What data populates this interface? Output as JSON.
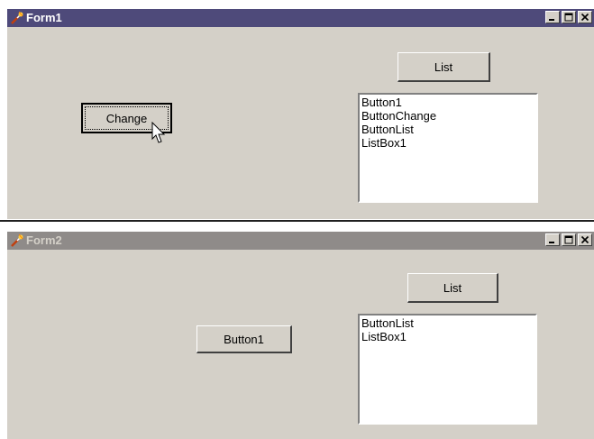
{
  "form1": {
    "title": "Form1",
    "buttons": {
      "list_label": "List",
      "change_label": "Change"
    },
    "listbox_items": [
      "Button1",
      "ButtonChange",
      "ButtonList",
      "ListBox1"
    ]
  },
  "form2": {
    "title": "Form2",
    "buttons": {
      "list_label": "List",
      "button1_label": "Button1"
    },
    "listbox_items": [
      "ButtonList",
      "ListBox1"
    ]
  },
  "colors": {
    "active_titlebar": "#4e4a7a",
    "inactive_titlebar": "#8f8b89",
    "face": "#d4d0c8"
  },
  "icons": [
    "app-icon",
    "minimize-icon",
    "maximize-icon",
    "close-icon",
    "mouse-pointer-icon"
  ]
}
